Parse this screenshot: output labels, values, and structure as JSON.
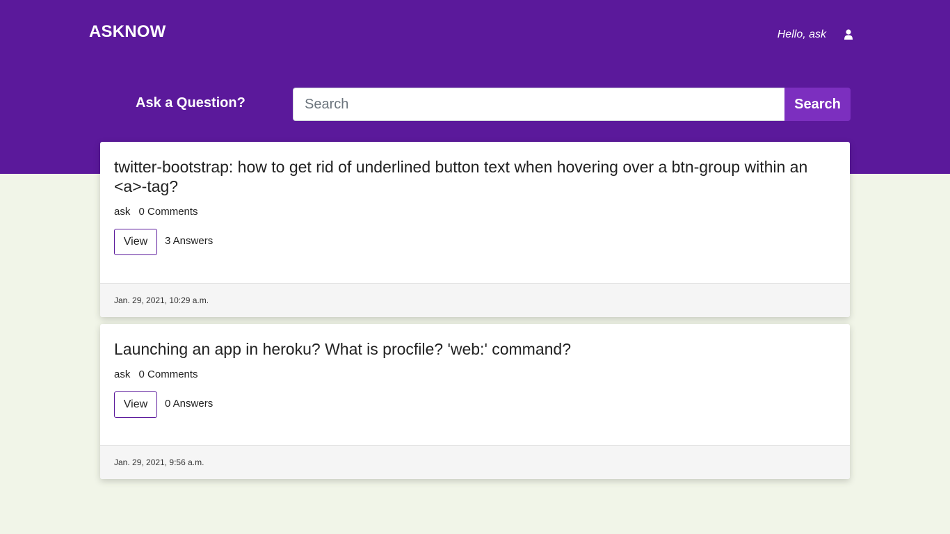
{
  "header": {
    "brand": "ASKNOW",
    "greeting": "Hello, ask",
    "ask_link": "Ask a Question?"
  },
  "search": {
    "placeholder": "Search",
    "value": "",
    "button_label": "Search"
  },
  "questions": [
    {
      "title": "twitter-bootstrap: how to get rid of underlined button text when hovering over a btn-group within an <a>-tag?",
      "author": "ask",
      "comments": "0 Comments",
      "view_label": "View",
      "answers": "3 Answers",
      "date": "Jan. 29, 2021, 10:29 a.m."
    },
    {
      "title": "Launching an app in heroku? What is procfile? 'web:' command?",
      "author": "ask",
      "comments": "0 Comments",
      "view_label": "View",
      "answers": "0 Answers",
      "date": "Jan. 29, 2021, 9:56 a.m."
    }
  ],
  "icons": {
    "user": "user-icon"
  },
  "colors": {
    "header_bg": "#5b199b",
    "search_button": "#7c2fbf",
    "page_bg": "#f1f5e8"
  }
}
